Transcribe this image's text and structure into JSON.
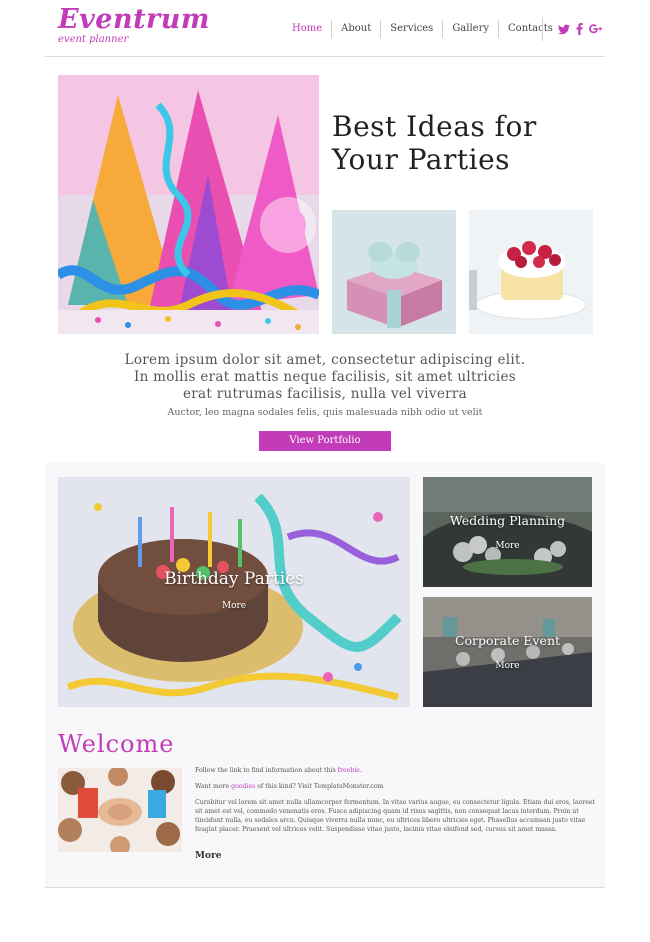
{
  "header": {
    "logo_title": "Eventrum",
    "logo_sub": "event planner",
    "nav": [
      {
        "label": "Home"
      },
      {
        "label": "About"
      },
      {
        "label": "Services"
      },
      {
        "label": "Gallery"
      },
      {
        "label": "Contacts"
      }
    ],
    "social": [
      {
        "icon": "twitter-icon",
        "glyph": "𝕥"
      },
      {
        "icon": "facebook-icon",
        "glyph": "f"
      },
      {
        "icon": "google-plus-icon",
        "glyph": "g+"
      }
    ]
  },
  "hero": {
    "title_line1": "Best Ideas for",
    "title_line2": "Your Parties",
    "intro_line1": "Lorem ipsum dolor sit amet, consectetur adipiscing elit.",
    "intro_line2": "In mollis erat mattis neque facilisis, sit amet ultricies",
    "intro_line3": "erat rutrumas facilisis, nulla vel viverra",
    "intro_small": "Auctor, leo magna sodales felis, quis malesuada nibh odio ut velit",
    "button": "View Portfolio"
  },
  "gallery": [
    {
      "title": "Birthday Parties",
      "more": "More"
    },
    {
      "title": "Wedding Planning",
      "more": "More"
    },
    {
      "title": "Corporate Event",
      "more": "More"
    }
  ],
  "welcome": {
    "title": "Welcome",
    "line1_pre": "Follow the link to find information about this ",
    "line1_link": "freebie",
    "line1_post": ".",
    "line2_pre": "Want more ",
    "line2_link": "goodies",
    "line2_post": " of this kind? Visit TemplateMonster.com",
    "body": "Curabitur vel lorem sit amet nulla ullamcorper fermentum. In vitae varius augue, eu consectetur ligula. Etiam dui eros, laoreet sit amet est vel, commodo venenatis eros. Fusce adipiscing quam id risus sagittis, non consequat lacus interdum. Proin ut tincidunt nulla, eu sodales arcu. Quisque viverra nulla nunc, eu ultrices libero ultricies eget. Phasellus accumsan justo vitae feugiat placer. Praesent vel ultrices velit. Suspendisse vitae justo, lacinia vitae eleifend sed, cursus sit amet massa.",
    "more": "More"
  },
  "colors": {
    "accent": "#c23bb8"
  }
}
